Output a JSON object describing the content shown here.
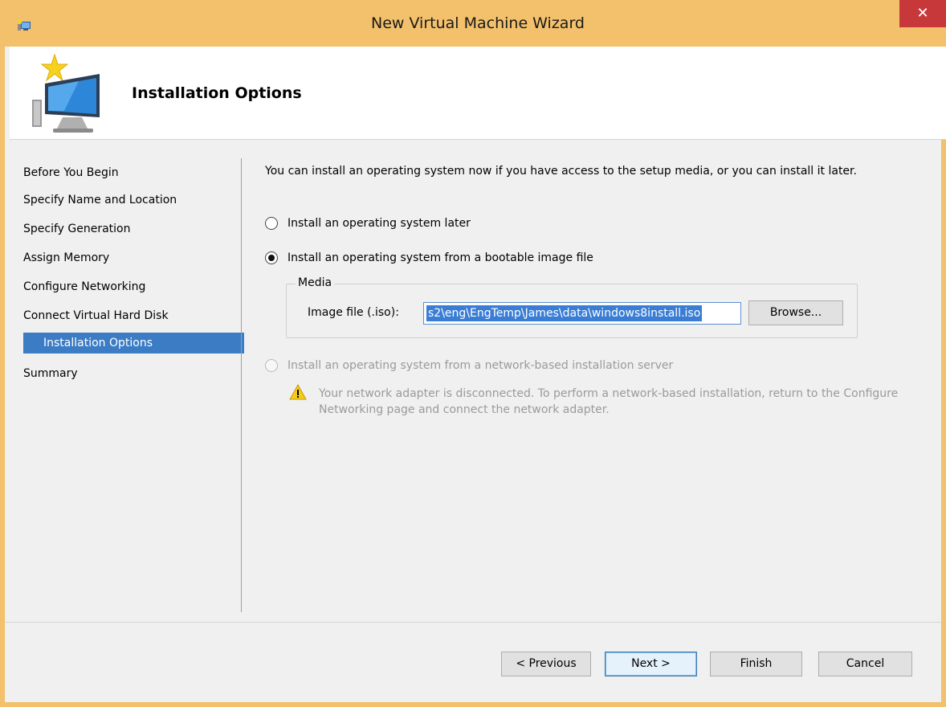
{
  "window": {
    "title": "New Virtual Machine Wizard",
    "close_glyph": "✕"
  },
  "header": {
    "title": "Installation Options",
    "icon": "virtual-machine-wizard-icon"
  },
  "sidebar": {
    "items": [
      {
        "label": "Before You Begin",
        "active": false
      },
      {
        "label": "Specify Name and Location",
        "active": false
      },
      {
        "label": "Specify Generation",
        "active": false
      },
      {
        "label": "Assign Memory",
        "active": false
      },
      {
        "label": "Configure Networking",
        "active": false
      },
      {
        "label": "Connect Virtual Hard Disk",
        "active": false
      },
      {
        "label": "Installation Options",
        "active": true
      },
      {
        "label": "Summary",
        "active": false
      }
    ]
  },
  "main": {
    "intro": "You can install an operating system now if you have access to the setup media, or you can install it later.",
    "options": [
      {
        "label": "Install an operating system later",
        "selected": false,
        "enabled": true
      },
      {
        "label": "Install an operating system from a bootable image file",
        "selected": true,
        "enabled": true
      },
      {
        "label": "Install an operating system from a network-based installation server",
        "selected": false,
        "enabled": false
      }
    ],
    "media": {
      "legend": "Media",
      "image_label": "Image file (.iso):",
      "image_value": "s2\\eng\\EngTemp\\James\\data\\windows8install.iso",
      "browse_label": "Browse..."
    },
    "warning": "Your network adapter is disconnected. To perform a network-based installation, return to the Configure Networking page and connect the network adapter."
  },
  "footer": {
    "previous_label": "< Previous",
    "next_label": "Next >",
    "finish_label": "Finish",
    "cancel_label": "Cancel"
  },
  "colors": {
    "title_bar": "#f3c06b",
    "close_button": "#c7383b",
    "nav_active": "#3b7cc5",
    "selection": "#3a7dd4"
  }
}
